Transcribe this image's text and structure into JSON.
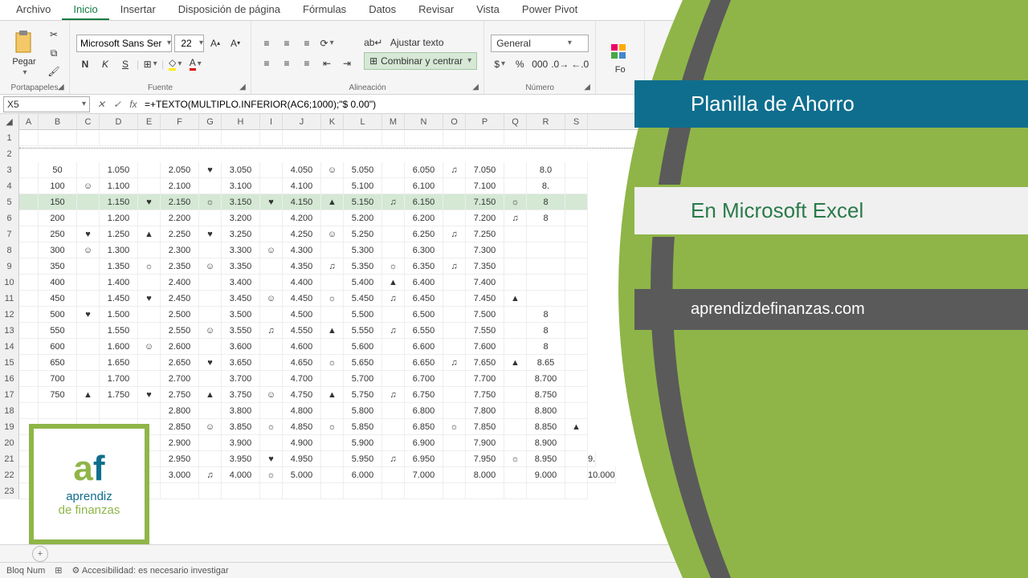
{
  "tabs": [
    "Archivo",
    "Inicio",
    "Insertar",
    "Disposición de página",
    "Fórmulas",
    "Datos",
    "Revisar",
    "Vista",
    "Power Pivot"
  ],
  "active_tab": 1,
  "clipboard": {
    "paste": "Pegar",
    "label": "Portapapeles"
  },
  "font": {
    "name": "Microsoft Sans Serif",
    "size": "22",
    "label": "Fuente",
    "bold": "N",
    "italic": "K",
    "underline": "S"
  },
  "align": {
    "wrap": "Ajustar texto",
    "merge": "Combinar y centrar",
    "label": "Alineación"
  },
  "number": {
    "format": "General",
    "label": "Número"
  },
  "styles": {
    "cond": "Fo"
  },
  "name_box": "X5",
  "formula": "=+TEXTO(MULTIPLO.INFERIOR(AC6;1000);\"$ 0.00\")",
  "cols": [
    "A",
    "B",
    "C",
    "D",
    "E",
    "F",
    "G",
    "H",
    "I",
    "J",
    "K",
    "L",
    "M",
    "N",
    "O",
    "P",
    "Q",
    "R",
    "S"
  ],
  "rows": [
    {
      "r": 1,
      "cells": [
        "",
        "",
        "",
        "",
        "",
        "",
        "",
        "",
        "",
        "",
        "",
        "",
        "",
        "",
        "",
        "",
        "",
        "",
        ""
      ]
    },
    {
      "r": 2,
      "dotted": true
    },
    {
      "r": 3,
      "cells": [
        "",
        "50",
        "",
        "1.050",
        "",
        "2.050",
        "♥",
        "3.050",
        "",
        "4.050",
        "☺",
        "5.050",
        "",
        "6.050",
        "♫",
        "7.050",
        "",
        "8.0",
        ""
      ]
    },
    {
      "r": 4,
      "cells": [
        "",
        "100",
        "☺",
        "1.100",
        "",
        "2.100",
        "",
        "3.100",
        "",
        "4.100",
        "",
        "5.100",
        "",
        "6.100",
        "",
        "7.100",
        "",
        "8.",
        ""
      ]
    },
    {
      "r": 5,
      "cells": [
        "",
        "150",
        "",
        "1.150",
        "♥",
        "2.150",
        "☼",
        "3.150",
        "♥",
        "4.150",
        "▲",
        "5.150",
        "♫",
        "6.150",
        "",
        "7.150",
        "☼",
        "8",
        ""
      ],
      "sel": true
    },
    {
      "r": 6,
      "cells": [
        "",
        "200",
        "",
        "1.200",
        "",
        "2.200",
        "",
        "3.200",
        "",
        "4.200",
        "",
        "5.200",
        "",
        "6.200",
        "",
        "7.200",
        "♫",
        "8",
        ""
      ]
    },
    {
      "r": 7,
      "cells": [
        "",
        "250",
        "♥",
        "1.250",
        "▲",
        "2.250",
        "♥",
        "3.250",
        "",
        "4.250",
        "☺",
        "5.250",
        "",
        "6.250",
        "♫",
        "7.250",
        "",
        "",
        ""
      ]
    },
    {
      "r": 8,
      "cells": [
        "",
        "300",
        "☺",
        "1.300",
        "",
        "2.300",
        "",
        "3.300",
        "☺",
        "4.300",
        "",
        "5.300",
        "",
        "6.300",
        "",
        "7.300",
        "",
        "",
        ""
      ]
    },
    {
      "r": 9,
      "cells": [
        "",
        "350",
        "",
        "1.350",
        "☼",
        "2.350",
        "☺",
        "3.350",
        "",
        "4.350",
        "♫",
        "5.350",
        "☼",
        "6.350",
        "♫",
        "7.350",
        "",
        "",
        ""
      ]
    },
    {
      "r": 10,
      "cells": [
        "",
        "400",
        "",
        "1.400",
        "",
        "2.400",
        "",
        "3.400",
        "",
        "4.400",
        "",
        "5.400",
        "▲",
        "6.400",
        "",
        "7.400",
        "",
        "",
        ""
      ]
    },
    {
      "r": 11,
      "cells": [
        "",
        "450",
        "",
        "1.450",
        "♥",
        "2.450",
        "",
        "3.450",
        "☺",
        "4.450",
        "☼",
        "5.450",
        "♫",
        "6.450",
        "",
        "7.450",
        "▲",
        "",
        ""
      ]
    },
    {
      "r": 12,
      "cells": [
        "",
        "500",
        "♥",
        "1.500",
        "",
        "2.500",
        "",
        "3.500",
        "",
        "4.500",
        "",
        "5.500",
        "",
        "6.500",
        "",
        "7.500",
        "",
        "8",
        ""
      ]
    },
    {
      "r": 13,
      "cells": [
        "",
        "550",
        "",
        "1.550",
        "",
        "2.550",
        "☺",
        "3.550",
        "♫",
        "4.550",
        "▲",
        "5.550",
        "♫",
        "6.550",
        "",
        "7.550",
        "",
        "8",
        ""
      ]
    },
    {
      "r": 14,
      "cells": [
        "",
        "600",
        "",
        "1.600",
        "☺",
        "2.600",
        "",
        "3.600",
        "",
        "4.600",
        "",
        "5.600",
        "",
        "6.600",
        "",
        "7.600",
        "",
        "8",
        ""
      ]
    },
    {
      "r": 15,
      "cells": [
        "",
        "650",
        "",
        "1.650",
        "",
        "2.650",
        "♥",
        "3.650",
        "",
        "4.650",
        "☼",
        "5.650",
        "",
        "6.650",
        "♫",
        "7.650",
        "▲",
        "8.65",
        ""
      ]
    },
    {
      "r": 16,
      "cells": [
        "",
        "700",
        "",
        "1.700",
        "",
        "2.700",
        "",
        "3.700",
        "",
        "4.700",
        "",
        "5.700",
        "",
        "6.700",
        "",
        "7.700",
        "",
        "8.700",
        ""
      ]
    },
    {
      "r": 17,
      "cells": [
        "",
        "750",
        "▲",
        "1.750",
        "♥",
        "2.750",
        "▲",
        "3.750",
        "☺",
        "4.750",
        "▲",
        "5.750",
        "♫",
        "6.750",
        "",
        "7.750",
        "",
        "8.750",
        ""
      ]
    },
    {
      "r": 18,
      "cells": [
        "",
        "",
        "",
        "",
        "",
        "2.800",
        "",
        "3.800",
        "",
        "4.800",
        "",
        "5.800",
        "",
        "6.800",
        "",
        "7.800",
        "",
        "8.800",
        ""
      ]
    },
    {
      "r": 19,
      "cells": [
        "",
        "",
        "",
        "",
        "",
        "2.850",
        "☺",
        "3.850",
        "☼",
        "4.850",
        "☼",
        "5.850",
        "",
        "6.850",
        "☼",
        "7.850",
        "",
        "8.850",
        "▲"
      ]
    },
    {
      "r": 20,
      "cells": [
        "",
        "",
        "",
        "",
        "",
        "2.900",
        "",
        "3.900",
        "",
        "4.900",
        "",
        "5.900",
        "",
        "6.900",
        "",
        "7.900",
        "",
        "8.900",
        ""
      ]
    },
    {
      "r": 21,
      "cells": [
        "",
        "",
        "",
        "",
        "",
        "2.950",
        "",
        "3.950",
        "♥",
        "4.950",
        "",
        "5.950",
        "♫",
        "6.950",
        "",
        "7.950",
        "☼",
        "8.950",
        "",
        "9."
      ]
    },
    {
      "r": 22,
      "cells": [
        "",
        "",
        "",
        "",
        "",
        "3.000",
        "♫",
        "4.000",
        "☼",
        "5.000",
        "",
        "6.000",
        "",
        "7.000",
        "",
        "8.000",
        "",
        "9.000",
        "",
        "10.000"
      ]
    },
    {
      "r": 23,
      "cells": [
        "",
        "",
        "",
        "",
        "",
        "",
        "",
        "",
        "",
        "",
        "",
        "",
        "",
        "",
        "",
        "",
        "",
        "",
        ""
      ]
    }
  ],
  "status": {
    "bloq": "Bloq Num",
    "acc": "Accesibilidad: es necesario investigar"
  },
  "overlay": {
    "title": "Planilla de Ahorro",
    "sub": "En Microsoft Excel",
    "site": "aprendizdefinanzas.com",
    "logo1": "aprendiz",
    "logo2": "de finanzas"
  }
}
